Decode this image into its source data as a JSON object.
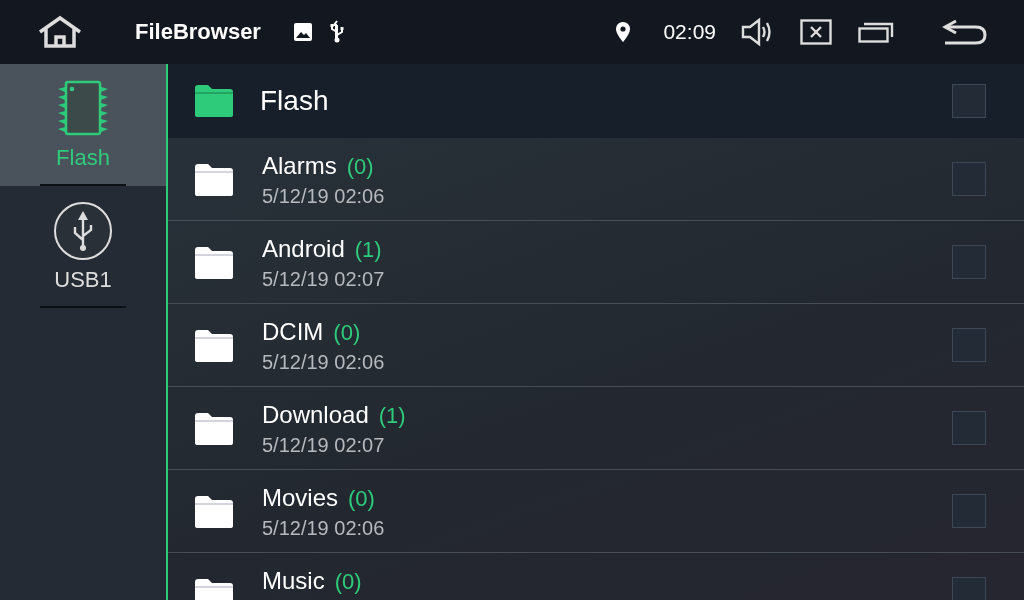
{
  "status_bar": {
    "app_title": "FileBrowser",
    "time": "02:09"
  },
  "sidebar": {
    "items": [
      {
        "label": "Flash",
        "kind": "flash",
        "selected": true
      },
      {
        "label": "USB1",
        "kind": "usb",
        "selected": false
      }
    ]
  },
  "header": {
    "title": "Flash",
    "checked": false
  },
  "files": [
    {
      "name": "Alarms",
      "count": "(0)",
      "date": "5/12/19 02:06",
      "checked": false
    },
    {
      "name": "Android",
      "count": "(1)",
      "date": "5/12/19 02:07",
      "checked": false
    },
    {
      "name": "DCIM",
      "count": "(0)",
      "date": "5/12/19 02:06",
      "checked": false
    },
    {
      "name": "Download",
      "count": "(1)",
      "date": "5/12/19 02:07",
      "checked": false
    },
    {
      "name": "Movies",
      "count": "(0)",
      "date": "5/12/19 02:06",
      "checked": false
    },
    {
      "name": "Music",
      "count": "(0)",
      "checked": false
    }
  ]
}
